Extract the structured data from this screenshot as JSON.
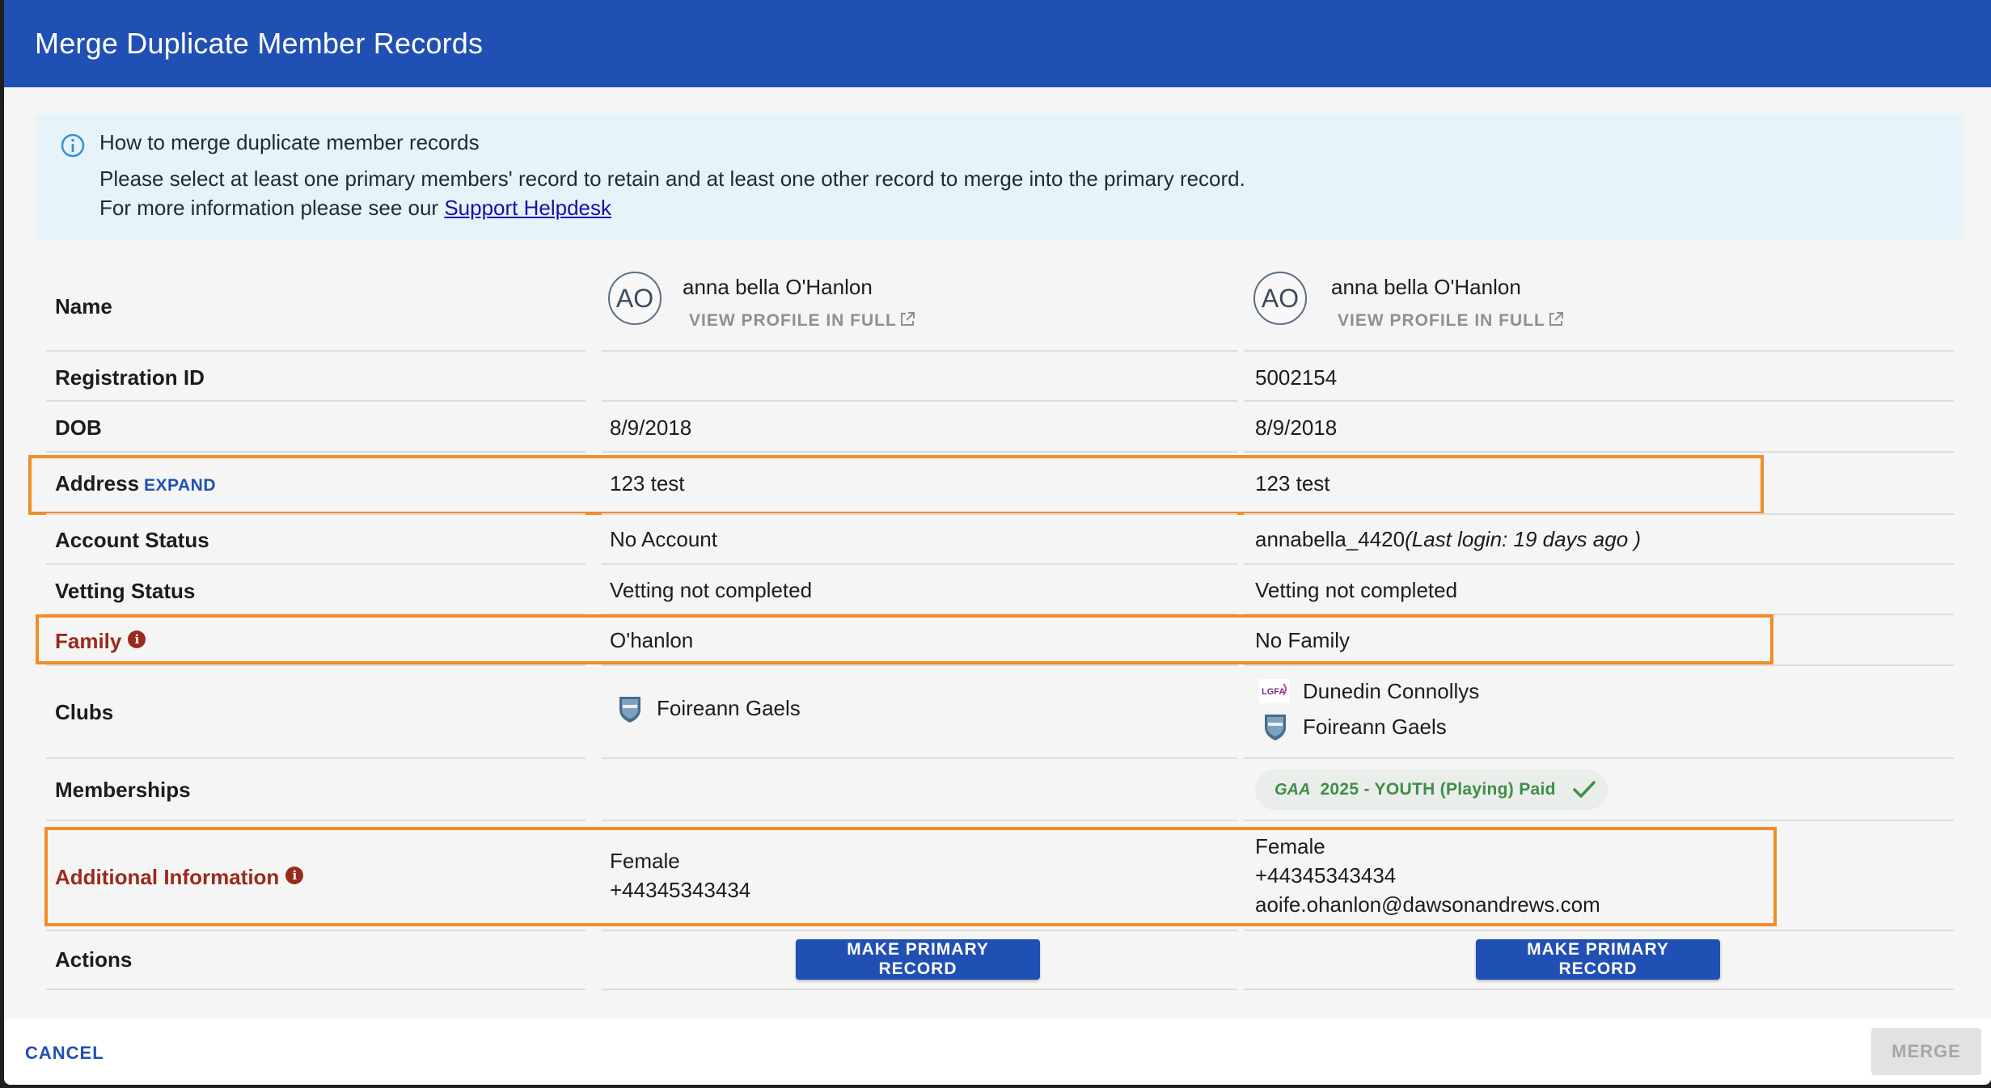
{
  "dialog": {
    "title": "Merge Duplicate Member Records"
  },
  "info": {
    "heading": "How to merge duplicate member records",
    "line1": "Please select at least one primary members' record to retain and at least one other record to merge into the primary record.",
    "line2_prefix": "For more information please see our ",
    "link": "Support Helpdesk"
  },
  "labels": {
    "name": "Name",
    "registration_id": "Registration ID",
    "dob": "DOB",
    "address": "Address",
    "expand": "EXPAND",
    "account_status": "Account Status",
    "vetting_status": "Vetting Status",
    "family": "Family",
    "clubs": "Clubs",
    "memberships": "Memberships",
    "additional_information": "Additional Information",
    "actions": "Actions"
  },
  "records": [
    {
      "initials": "AO",
      "name": "anna bella O'Hanlon",
      "view_profile": "VIEW PROFILE IN FULL",
      "registration_id": "",
      "dob": "8/9/2018",
      "address": "123 test",
      "account_status": "No Account",
      "account_login": "",
      "vetting_status": "Vetting not completed",
      "family": "O'hanlon",
      "clubs": [
        "Foireann Gaels"
      ],
      "membership": "",
      "additional": [
        "Female",
        "+44345343434"
      ],
      "action": "MAKE PRIMARY RECORD"
    },
    {
      "initials": "AO",
      "name": "anna bella O'Hanlon",
      "view_profile": "VIEW PROFILE IN FULL",
      "registration_id": "5002154",
      "dob": "8/9/2018",
      "address": "123 test",
      "account_status": "annabella_4420",
      "account_login": "(Last login: 19 days ago )",
      "vetting_status": "Vetting not completed",
      "family": "No Family",
      "clubs": [
        "Dunedin Connollys",
        "Foireann Gaels"
      ],
      "membership": "2025 - YOUTH (Playing) Paid",
      "additional": [
        "Female",
        "+44345343434",
        "aoife.ohanlon@dawsonandrews.com"
      ],
      "action": "MAKE PRIMARY RECORD"
    }
  ],
  "icons": {
    "membership_logo_text": "GAA",
    "club_logo_text": "LGFA"
  },
  "footer": {
    "cancel": "CANCEL",
    "merge": "MERGE"
  },
  "colors": {
    "primary": "#2150b4",
    "highlight": "#f28c28",
    "alert_label": "#9b2a1a",
    "success": "#3e8e48"
  }
}
